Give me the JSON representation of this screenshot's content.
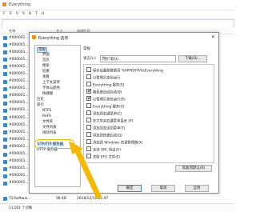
{
  "window": {
    "title": "Everything"
  },
  "menu": [
    "F",
    "E",
    "V",
    "S",
    "B",
    "T",
    "H"
  ],
  "columns": [
    "名称",
    "大小",
    "修改时间"
  ],
  "files": [
    "#000001...",
    "#000001...",
    "#000001...",
    "#000001...",
    "#000001...",
    "#000001...",
    "#000001...",
    "#000001...",
    "#000001...",
    "#000001...",
    "#000001...",
    "#000001...",
    "#000001...",
    "#000001...",
    "#000001...",
    "#000001...",
    "#000001...",
    "#000001...",
    "#000001...",
    "#000001...",
    "#000001..."
  ],
  "status_row": {
    "name": "T1/Softwar...",
    "size": "98 KB",
    "date": "2018/12/19 21:47"
  },
  "status": "11,001 个对象",
  "dialog": {
    "title": "Everything 选项",
    "close": "✕",
    "tree": [
      "常规",
      "界面",
      "首页",
      "搜索",
      "结果",
      "查看",
      "上下文菜单",
      "字体与颜色",
      "快捷键",
      "历史",
      "索引",
      "NTFS",
      "ReFS",
      "文件夹",
      "文件列表",
      "排除列表",
      "ETP/FTP 服务器",
      "HTTP 服务器"
    ],
    "section": "常规",
    "language_label": "语言(L):",
    "language_value": "(用户默认)",
    "download_button": "下载(D)...",
    "options": [
      {
        "label": "保存设置和数据到 %APPDATA%\\Everything",
        "checked": false
      },
      {
        "label": "以管理员身份运行",
        "checked": false
      },
      {
        "label": "Everything 服务(S)",
        "checked": false
      },
      {
        "label": "随系统自动启动(B)",
        "checked": true
      },
      {
        "label": "以管理员身份运行(R)",
        "checked": true
      },
      {
        "label": "Everything 服务(V)",
        "checked": false
      },
      {
        "label": "添加到右键菜单(C)",
        "checked": false
      },
      {
        "label": "在文件夹右键菜单显示 (P)",
        "checked": false
      },
      {
        "label": "添加到发送到菜单(T)",
        "checked": false
      },
      {
        "label": "添加到快速启动(Q)",
        "checked": false
      },
      {
        "label": "添加到 Windows 资源管理器(X)",
        "checked": false
      },
      {
        "label": "支持 URL 协议(U)",
        "checked": false
      },
      {
        "label": "关联 EFU 文件(E)",
        "checked": false
      }
    ],
    "restore_button": "恢复到默认(R)",
    "ok": "确定",
    "cancel": "取消",
    "apply": "应用"
  },
  "annotation": {
    "color": "#f5b800"
  }
}
